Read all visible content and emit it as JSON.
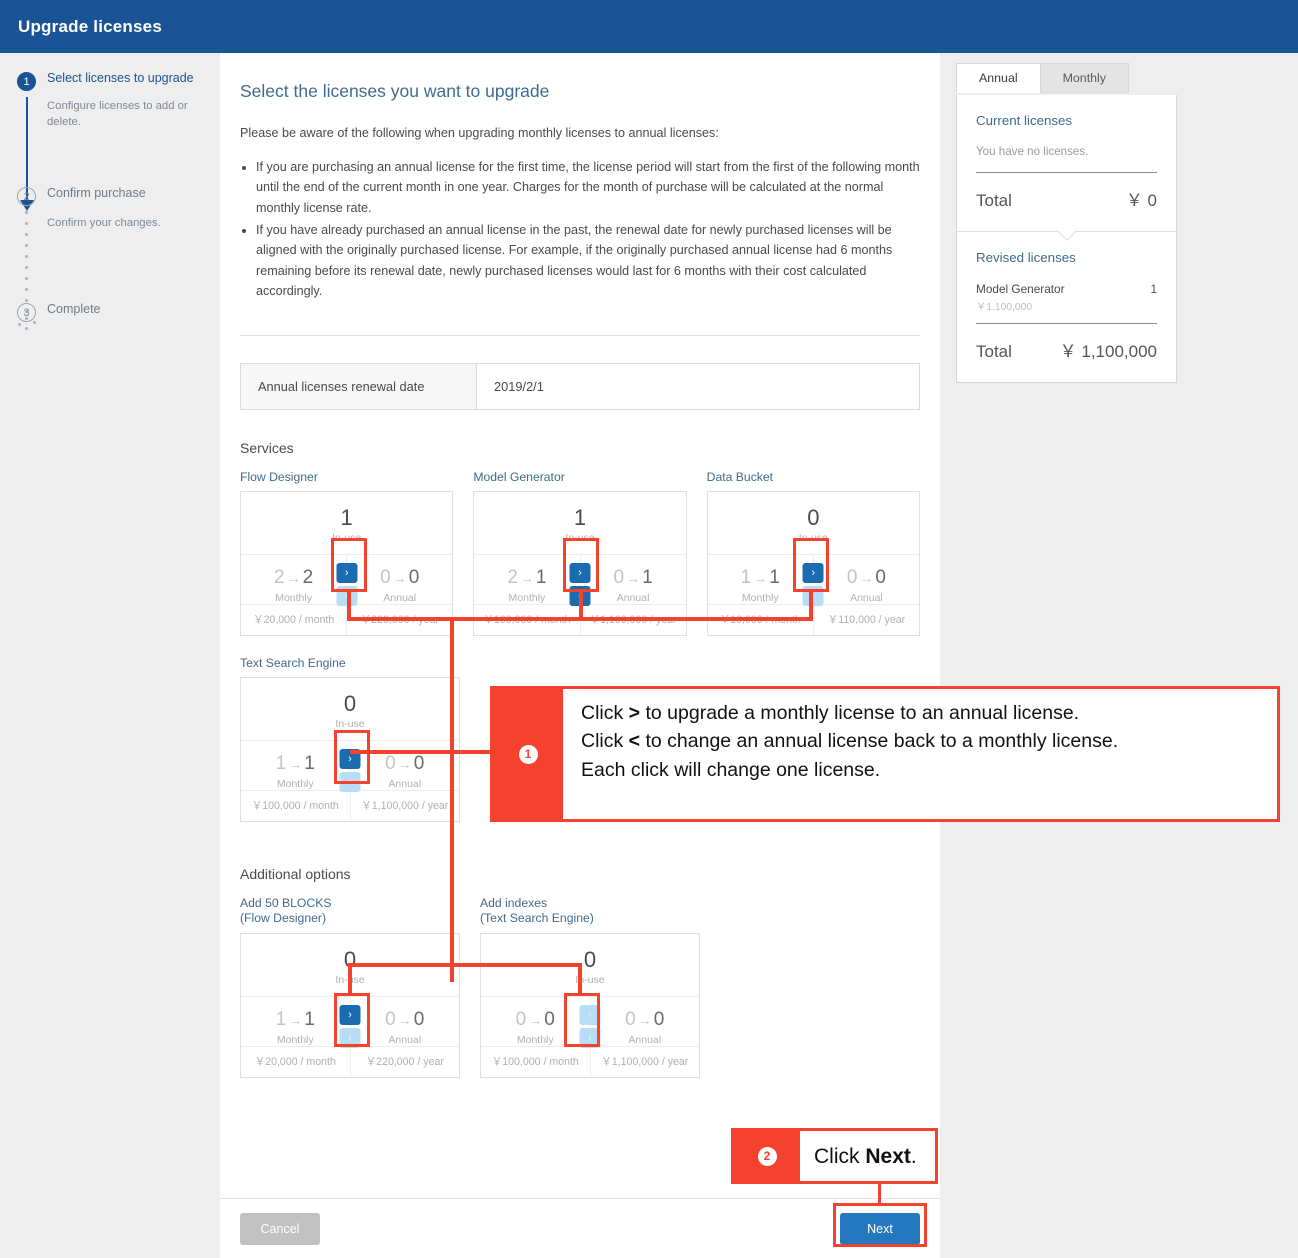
{
  "window": {
    "title": "Upgrade licenses"
  },
  "steps": [
    {
      "num": "1",
      "title": "Select licenses to upgrade",
      "desc": "Configure licenses to add or delete.",
      "state": "active"
    },
    {
      "num": "2",
      "title": "Confirm purchase",
      "desc": "Confirm your changes.",
      "state": "idle"
    },
    {
      "num": "3",
      "title": "Complete",
      "desc": "",
      "state": "idle"
    }
  ],
  "main": {
    "title": "Select the licenses you want to upgrade",
    "intro": "Please be aware of the following when upgrading monthly licenses to annual licenses:",
    "notes": [
      "If you are purchasing an annual license for the first time, the license period will start from the first of the following month until the end of the current month in one year. Charges for the month of purchase will be calculated at the normal monthly license rate.",
      "If you have already purchased an annual license in the past, the renewal date for newly purchased licenses will be aligned with the originally purchased license. For example, if the originally purchased annual license had 6 months remaining before its renewal date, newly purchased licenses would last for 6 months with their cost calculated accordingly."
    ],
    "renewal_label": "Annual licenses renewal date",
    "renewal_value": "2019/2/1",
    "services_title": "Services",
    "options_title": "Additional options",
    "caption_inuse": "In-use",
    "caption_monthly": "Monthly",
    "caption_annual": "Annual",
    "arrow_glyph": "→",
    "next_glyph": "›",
    "prev_glyph": "‹"
  },
  "services": [
    {
      "name": "Flow Designer",
      "inuse": "1",
      "monthly_from": "2",
      "monthly_to": "2",
      "annual_from": "0",
      "annual_to": "0",
      "monthly_price": "￥20,000 / month",
      "annual_price": "￥220,000 / year",
      "up_enabled": true,
      "down_enabled": false,
      "highlight": true
    },
    {
      "name": "Model Generator",
      "inuse": "1",
      "monthly_from": "2",
      "monthly_to": "1",
      "annual_from": "0",
      "annual_to": "1",
      "monthly_price": "￥100,000 / month",
      "annual_price": "￥1,100,000 / year",
      "up_enabled": true,
      "down_enabled": true,
      "highlight": true
    },
    {
      "name": "Data Bucket",
      "inuse": "0",
      "monthly_from": "1",
      "monthly_to": "1",
      "annual_from": "0",
      "annual_to": "0",
      "monthly_price": "￥10,000 / month",
      "annual_price": "￥110,000 / year",
      "up_enabled": true,
      "down_enabled": false,
      "highlight": true
    },
    {
      "name": "Text Search Engine",
      "inuse": "0",
      "monthly_from": "1",
      "monthly_to": "1",
      "annual_from": "0",
      "annual_to": "0",
      "monthly_price": "￥100,000 / month",
      "annual_price": "￥1,100,000 / year",
      "up_enabled": true,
      "down_enabled": false,
      "highlight": true
    }
  ],
  "options": [
    {
      "name": "Add 50 BLOCKS",
      "name2": "(Flow Designer)",
      "inuse": "0",
      "monthly_from": "1",
      "monthly_to": "1",
      "annual_from": "0",
      "annual_to": "0",
      "monthly_price": "￥20,000 / month",
      "annual_price": "￥220,000 / year",
      "up_enabled": true,
      "down_enabled": false,
      "highlight": true
    },
    {
      "name": "Add indexes",
      "name2": "(Text Search Engine)",
      "inuse": "0",
      "monthly_from": "0",
      "monthly_to": "0",
      "annual_from": "0",
      "annual_to": "0",
      "monthly_price": "￥100,000 / month",
      "annual_price": "￥1,100,000 / year",
      "up_enabled": false,
      "down_enabled": false,
      "highlight": true
    }
  ],
  "summary": {
    "tabs": [
      {
        "label": "Annual",
        "selected": true
      },
      {
        "label": "Monthly",
        "selected": false
      }
    ],
    "current": {
      "heading": "Current licenses",
      "empty": "You have no licenses.",
      "total_label": "Total",
      "total_value": "￥ 0"
    },
    "revised": {
      "heading": "Revised licenses",
      "items": [
        {
          "name": "Model Generator",
          "qty": "1",
          "price": "￥1,100,000"
        }
      ],
      "total_label": "Total",
      "total_value": "￥ 1,100,000"
    }
  },
  "footer": {
    "cancel_label": "Cancel",
    "next_label": "Next"
  },
  "annotations": {
    "one": {
      "num": "①",
      "line1_a": "Click ",
      "line1_b": ">",
      "line1_c": " to upgrade a monthly license to an annual license.",
      "line2_a": "Click ",
      "line2_b": "<",
      "line2_c": " to change an annual license back to a monthly license.",
      "line3": "Each click will change one license."
    },
    "two": {
      "num": "②",
      "text_a": "Click ",
      "text_b": "Next",
      "text_c": "."
    }
  },
  "colors": {
    "brand": "#1b5496",
    "accent_blue": "#2577be",
    "annotation_red": "#f4422e",
    "disabled_blue": "#b8ddf5"
  }
}
